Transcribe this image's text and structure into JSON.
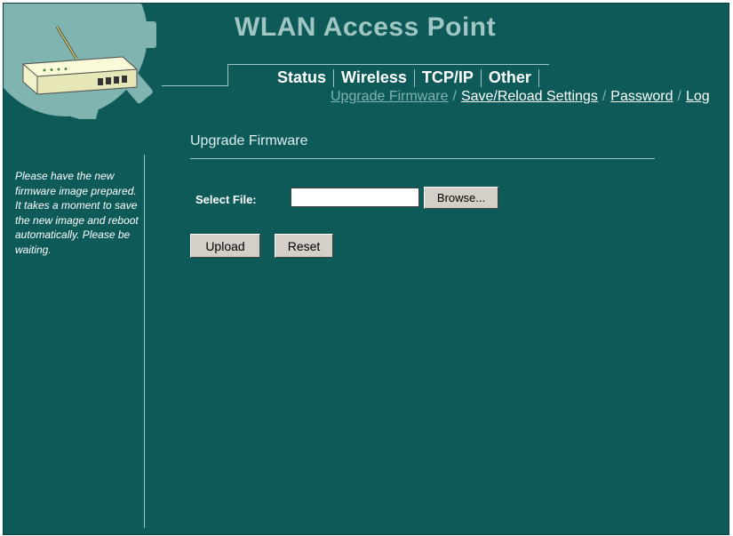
{
  "header": {
    "title": "WLAN Access Point"
  },
  "tabs": [
    {
      "label": "Status"
    },
    {
      "label": "Wireless"
    },
    {
      "label": "TCP/IP"
    },
    {
      "label": "Other"
    }
  ],
  "subnav": [
    {
      "label": "Upgrade Firmware",
      "active": true
    },
    {
      "label": "Save/Reload Settings"
    },
    {
      "label": "Password"
    },
    {
      "label": "Log"
    }
  ],
  "sidebar": {
    "help_text": "Please have the new firmware image prepared. It takes a moment to save the new image and reboot automatically. Please be waiting."
  },
  "main": {
    "page_title": "Upgrade Firmware",
    "select_file_label": "Select File:",
    "file_input_value": "",
    "browse_label": "Browse...",
    "upload_label": "Upload",
    "reset_label": "Reset"
  },
  "colors": {
    "background": "#0d5a58",
    "accent": "#9fc6c3",
    "link": "#ffffff",
    "active_link": "#7fb4b1"
  }
}
